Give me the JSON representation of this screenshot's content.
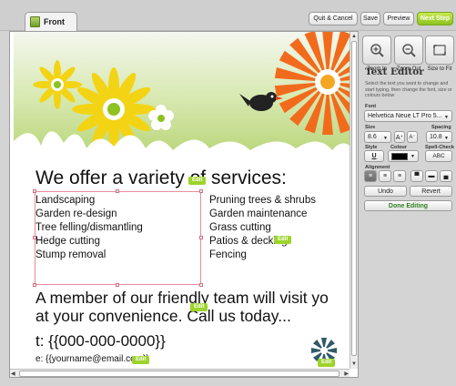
{
  "tabs": [
    {
      "label": "Front"
    }
  ],
  "toolbar": {
    "quit_label": "Quit & Cancel",
    "save_label": "Save",
    "preview_label": "Preview",
    "next_label": "Next Step"
  },
  "canvas": {
    "heading": "We offer a variety of services:",
    "left_list": [
      "Landscaping",
      "Garden re-design",
      "Tree felling/dismantling",
      "Hedge cutting",
      "Stump removal"
    ],
    "right_list": [
      "Pruning trees & shrubs",
      "Garden maintenance",
      "Grass cutting",
      "Patios & decking",
      "Fencing"
    ],
    "member_line1": "A member of our friendly team will visit yo",
    "member_line2": "at your convenience. Call us today...",
    "phone": "t: {{000-000-0000}}",
    "email": "e: {{yourname@email.com}}",
    "edit_badge": "Edit"
  },
  "panel": {
    "zoom_in": "Zoom In",
    "zoom_out": "Zoom Out",
    "size_to_fit": "Size to Fit",
    "title": "Text Editor",
    "description": "Select the text you want to change and start typing, then change the font, size or colours below",
    "font_label": "Font",
    "font_value": "Helvetica Neue LT Pro 5...",
    "size_label": "Size",
    "size_value": "8.6",
    "spacing_label": "Spacing",
    "spacing_value": "10.8",
    "style_label": "Style",
    "colour_label": "Colour",
    "spell_label": "Spell-Check",
    "spell_button": "ABC",
    "alignment_label": "Alignment",
    "undo_label": "Undo",
    "revert_label": "Revert",
    "done_label": "Done Editing",
    "text_colour": "#000000"
  },
  "colors": {
    "accent_green": "#8dc21f",
    "flower_orange": "#f26b1d",
    "flower_yellow": "#f3d415",
    "selection_pink": "#e88c9c"
  }
}
